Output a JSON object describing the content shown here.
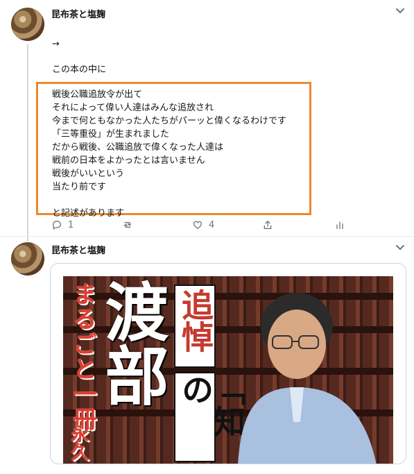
{
  "tweet1": {
    "author": "昆布茶と塩麹",
    "lines": [
      "→",
      "この本の中に"
    ],
    "highlight_lines": [
      "戦後公職追放令が出て",
      "それによって偉い人達はみんな追放され",
      "今まで何ともなかった人たちがパーッと偉くなるわけです",
      "「三等重役」が生まれました",
      "だから戦後、公職追放で偉くなった人達は",
      "戦前の日本をよかったとは言いません",
      "戦後がいいという",
      "当たり前です",
      "",
      "と記述があります"
    ],
    "reply_count": "1",
    "retweet_count": "",
    "like_count": "4"
  },
  "tweet2": {
    "author": "昆布茶と塩麹",
    "image_text": {
      "left_red": "まるごと一冊",
      "left_big": "渡部",
      "white_box_1": "追悼",
      "white_box_2": "「知の",
      "red_small": "永久"
    }
  },
  "colors": {
    "highlight_border": "#ec8a2f",
    "text": "#14171a",
    "muted": "#657786",
    "line": "#cfd9de"
  },
  "icons": [
    "chevron-down-icon",
    "reply-icon",
    "retweet-icon",
    "like-icon",
    "share-icon",
    "analytics-icon"
  ]
}
